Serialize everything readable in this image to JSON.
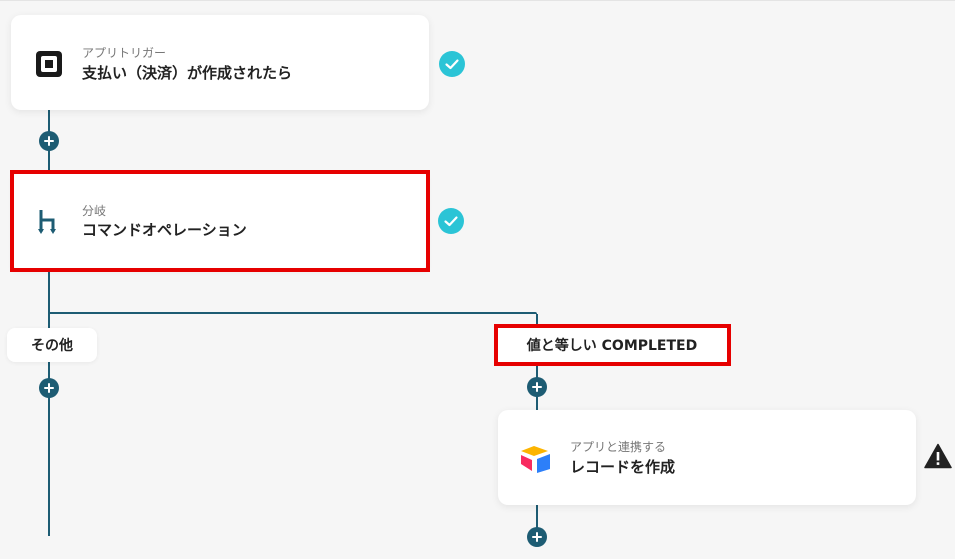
{
  "flow": {
    "trigger": {
      "label": "アプリトリガー",
      "title": "支払い（決済）が作成されたら",
      "icon": "square-app-icon",
      "status": "completed"
    },
    "branch": {
      "label": "分岐",
      "title": "コマンドオペレーション",
      "icon": "branch-icon",
      "status": "completed"
    },
    "branches": {
      "other_label": "その他",
      "condition_label": "値と等しい COMPLETED"
    },
    "action": {
      "label": "アプリと連携する",
      "title": "レコードを作成",
      "icon": "airtable-icon",
      "status": "warning"
    }
  },
  "colors": {
    "connector": "#1d5c73",
    "check": "#2bc4d6",
    "highlight": "#e60000",
    "warning": "#222222"
  }
}
